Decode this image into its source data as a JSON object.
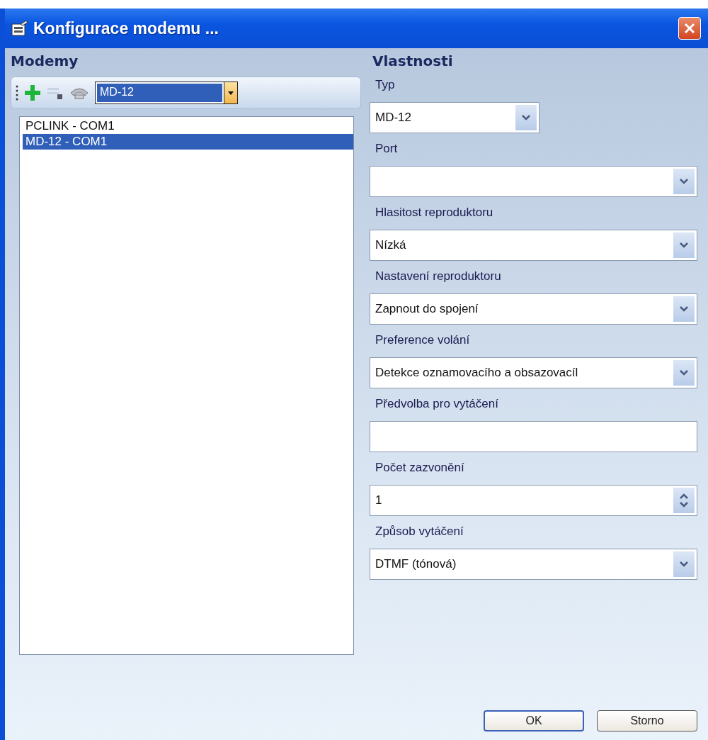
{
  "window": {
    "title": "Konfigurace modemu ..."
  },
  "modems": {
    "heading": "Modemy",
    "toolbar": {
      "selector_value": "MD-12"
    },
    "items": [
      {
        "label": "PCLINK - COM1",
        "selected": false
      },
      {
        "label": "MD-12 - COM1",
        "selected": true
      }
    ]
  },
  "properties": {
    "heading": "Vlastnosti",
    "fields": [
      {
        "kind": "combo",
        "label": "Typ",
        "value": "MD-12"
      },
      {
        "kind": "combo",
        "label": "Port"
      },
      {
        "kind": "combo",
        "label": "Hlasitost reproduktoru",
        "value": "Nízká"
      },
      {
        "kind": "combo",
        "label": "Nastavení reproduktoru",
        "value": "Zapnout do spojení"
      },
      {
        "kind": "combo",
        "label": "Preference volání",
        "value": "Detekce oznamovacího a obsazovacíl"
      },
      {
        "kind": "text",
        "label": "Předvolba pro vytáčení"
      },
      {
        "kind": "spinner",
        "label": "Počet zazvonění",
        "value": "1"
      },
      {
        "kind": "combo",
        "label": "Způsob vytáčení",
        "value": "DTMF (tónová)"
      }
    ]
  },
  "buttons": [
    {
      "label": "OK",
      "default": true
    },
    {
      "label": "Storno",
      "default": false
    }
  ]
}
